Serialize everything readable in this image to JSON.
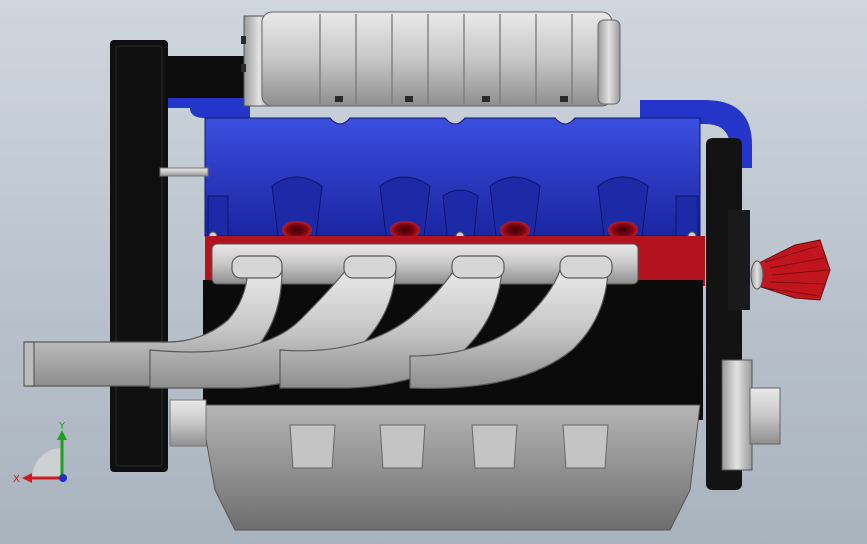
{
  "view": {
    "background_top": "#cfd6de",
    "background_bottom": "#a9b3be",
    "colors": {
      "intake_blue": "#2336c9",
      "gasket_red": "#b3121e",
      "block_black": "#0b0b0b",
      "metal_gray": "#c9c9c9",
      "air_filter_red": "#c2161f"
    }
  },
  "triad": {
    "x_label": "X",
    "y_label": "Y",
    "x_color": "#d11c1c",
    "y_color": "#1aa31a",
    "z_color": "#1d2fd1"
  }
}
